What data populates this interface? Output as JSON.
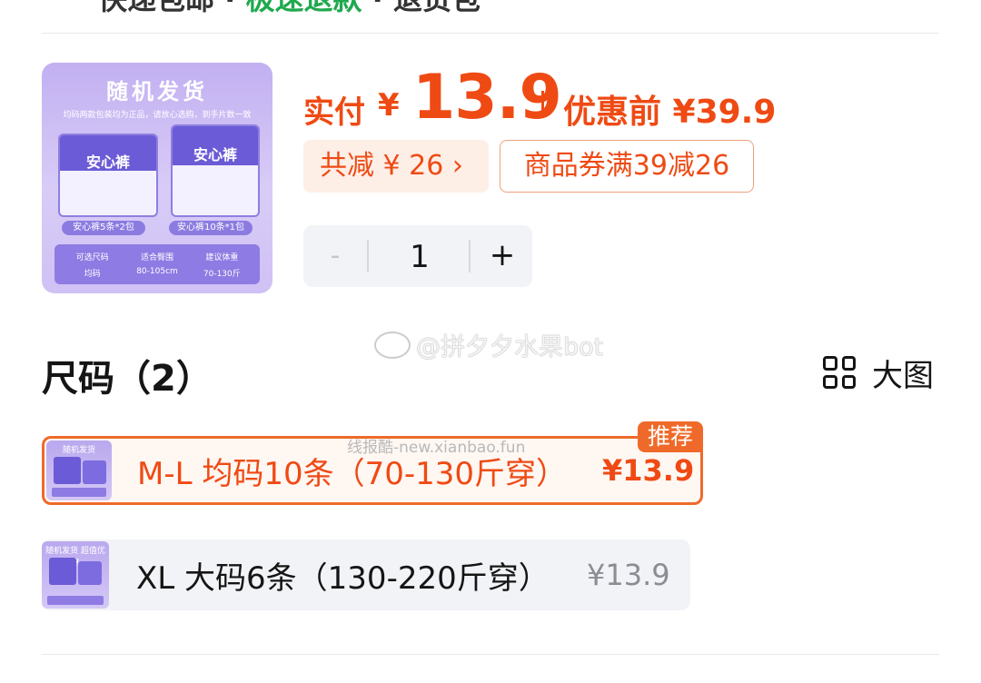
{
  "header": {
    "cut_text_prefix": "快递包邮 · ",
    "cut_text_highlight": "极速退款",
    "cut_text_suffix": " · 退货包"
  },
  "product": {
    "thumb_title": "随机发货",
    "thumb_subtitle": "均码两款包装均为正品，请放心选购，到手片数一致",
    "pack_brand": "安心裤",
    "pack_label_1": "安心裤5条*2包",
    "pack_label_2": "安心裤10条*1包",
    "spec_headers": [
      "可选尺码",
      "适合臀围",
      "建议体重"
    ],
    "spec_values": [
      "均码",
      "80-105cm",
      "70-130斤"
    ]
  },
  "price": {
    "paid_label": "实付",
    "currency": "¥",
    "paid_int": "13",
    "paid_dec": ".9",
    "original": "优惠前 ¥39.9",
    "save_tag": "共减 ¥ 26 ›",
    "coupon_tag": "商品券满39减26"
  },
  "quantity": {
    "minus": "-",
    "value": "1",
    "plus": "+"
  },
  "watermark": {
    "text": "@拼夕夕水果bot",
    "text2": "线报酷-new.xianbao.fun"
  },
  "size_section": {
    "title": "尺码（2）",
    "big_view_label": "大图",
    "recommend_badge": "推荐",
    "options": [
      {
        "label": "M-L 均码10条（70-130斤穿）",
        "price": "¥13.9",
        "selected": true,
        "thumb_text": "随机发货"
      },
      {
        "label": "XL 大码6条（130-220斤穿）",
        "price": "¥13.9",
        "selected": false,
        "thumb_text": "随机发货 超值优惠"
      }
    ]
  },
  "colors": {
    "accent": "#ef4a14",
    "selected_border": "#ef6a2a",
    "green_highlight": "#1fa94d",
    "stepper_bg": "#f2f3f6"
  }
}
